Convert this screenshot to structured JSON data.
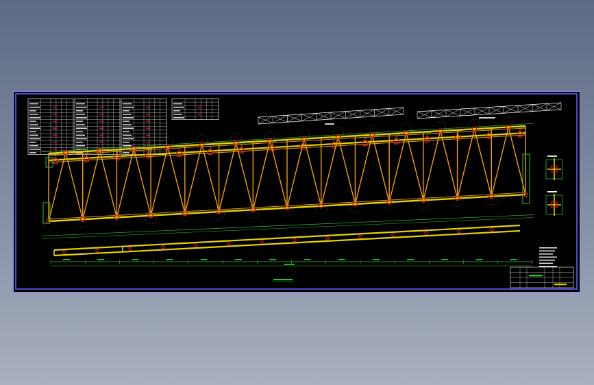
{
  "drawing": {
    "background_color": "#000000",
    "frame_color": "#4b4bd0",
    "colors": {
      "chord": "#e8d200",
      "web": "#f5a000",
      "node": "#d01818",
      "dimension": "#2fbf2f",
      "text": "#ffffff",
      "leader": "#d8d8d8"
    },
    "tables": [
      {
        "rows": 16,
        "cols": 6
      },
      {
        "rows": 16,
        "cols": 6
      },
      {
        "rows": 16,
        "cols": 6
      },
      {
        "rows": 6,
        "cols": 6
      }
    ],
    "top_chord_nodes": 16,
    "truss_panels": 14,
    "plan_panels": 10,
    "notes_lines": 7,
    "title_block": {
      "rows": 4,
      "cols": 6
    }
  }
}
